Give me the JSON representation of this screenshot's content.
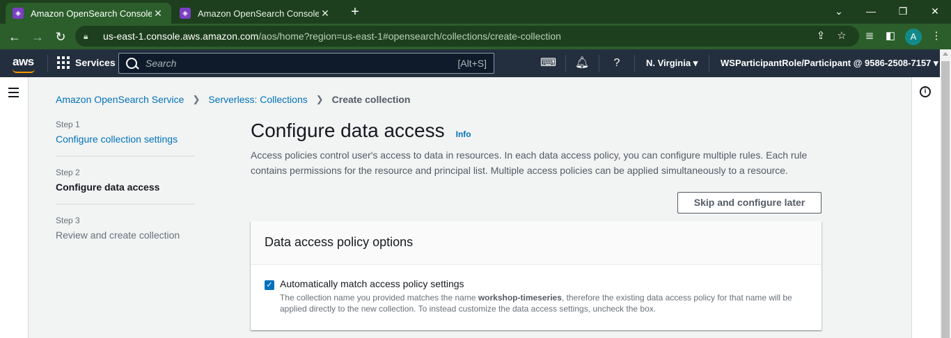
{
  "browser": {
    "tabs": [
      {
        "title": "Amazon OpenSearch Console",
        "active": true
      },
      {
        "title": "Amazon OpenSearch Console",
        "active": false
      }
    ],
    "url_host": "us-east-1.console.aws.amazon.com",
    "url_path": "/aos/home?region=us-east-1#opensearch/collections/create-collection",
    "profile_initial": "A"
  },
  "aws_nav": {
    "logo": "aws",
    "services_label": "Services",
    "search_placeholder": "Search",
    "search_shortcut": "[Alt+S]",
    "region": "N. Virginia",
    "account": "WSParticipantRole/Participant @ 9586-2508-7157"
  },
  "breadcrumb": {
    "items": [
      "Amazon OpenSearch Service",
      "Serverless: Collections"
    ],
    "current": "Create collection"
  },
  "steps": [
    {
      "num": "Step 1",
      "label": "Configure collection settings",
      "state": "link"
    },
    {
      "num": "Step 2",
      "label": "Configure data access",
      "state": "current"
    },
    {
      "num": "Step 3",
      "label": "Review and create collection",
      "state": "disabled"
    }
  ],
  "page": {
    "title": "Configure data access",
    "info": "Info",
    "description": "Access policies control user's access to data in resources. In each data access policy, you can configure multiple rules. Each rule contains permissions for the resource and principal list. Multiple access policies can be applied simultaneously to a resource.",
    "skip_button": "Skip and configure later"
  },
  "panel": {
    "title": "Data access policy options",
    "checkbox_label": "Automatically match access policy settings",
    "checkbox_checked": true,
    "desc_before": "The collection name you provided matches the name ",
    "desc_bold": "workshop-timeseries",
    "desc_after": ", therefore the existing data access policy for that name will be applied directly to the new collection. To instead customize the data access settings, uncheck the box."
  },
  "colors": {
    "browser_frame": "#1f4a1f",
    "aws_nav": "#232f3e",
    "link": "#0073bb",
    "aws_orange": "#ff9900"
  }
}
